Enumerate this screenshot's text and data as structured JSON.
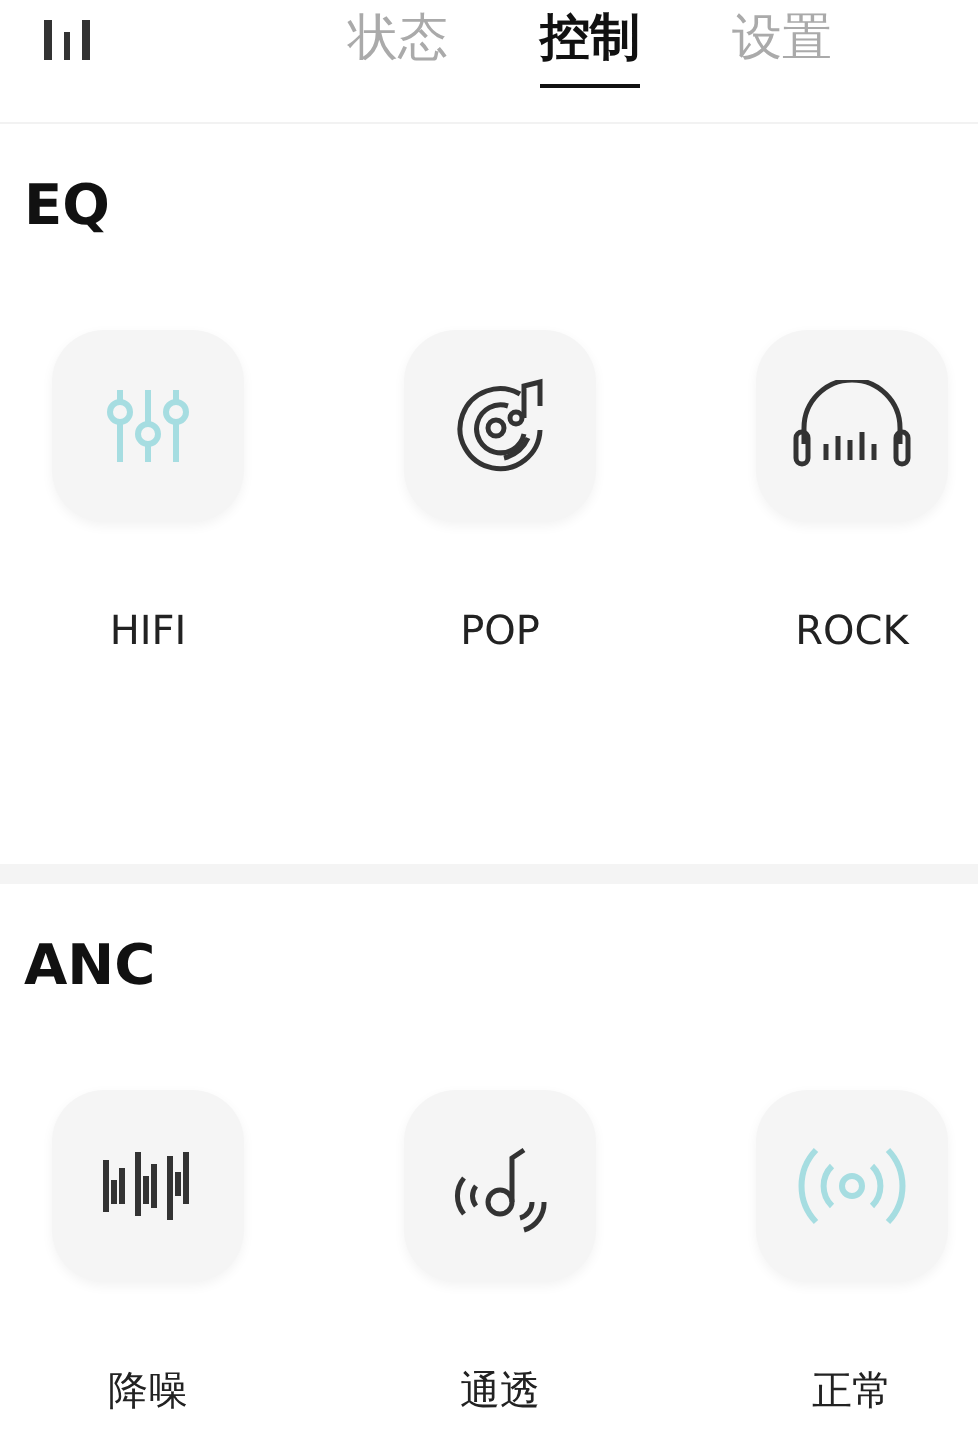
{
  "tabs": [
    {
      "label": "状态",
      "selected": false
    },
    {
      "label": "控制",
      "selected": true
    },
    {
      "label": "设置",
      "selected": false
    }
  ],
  "sections": [
    {
      "title": "EQ",
      "modes": [
        {
          "label": "HIFI",
          "kind": "sliders",
          "selected": true
        },
        {
          "label": "POP",
          "kind": "vinyl",
          "selected": false
        },
        {
          "label": "ROCK",
          "kind": "headphones",
          "selected": false
        }
      ]
    },
    {
      "title": "ANC",
      "modes": [
        {
          "label": "降噪",
          "kind": "bars",
          "selected": false
        },
        {
          "label": "通透",
          "kind": "transparent",
          "selected": false
        },
        {
          "label": "正常",
          "kind": "signal",
          "selected": true
        }
      ]
    }
  ]
}
